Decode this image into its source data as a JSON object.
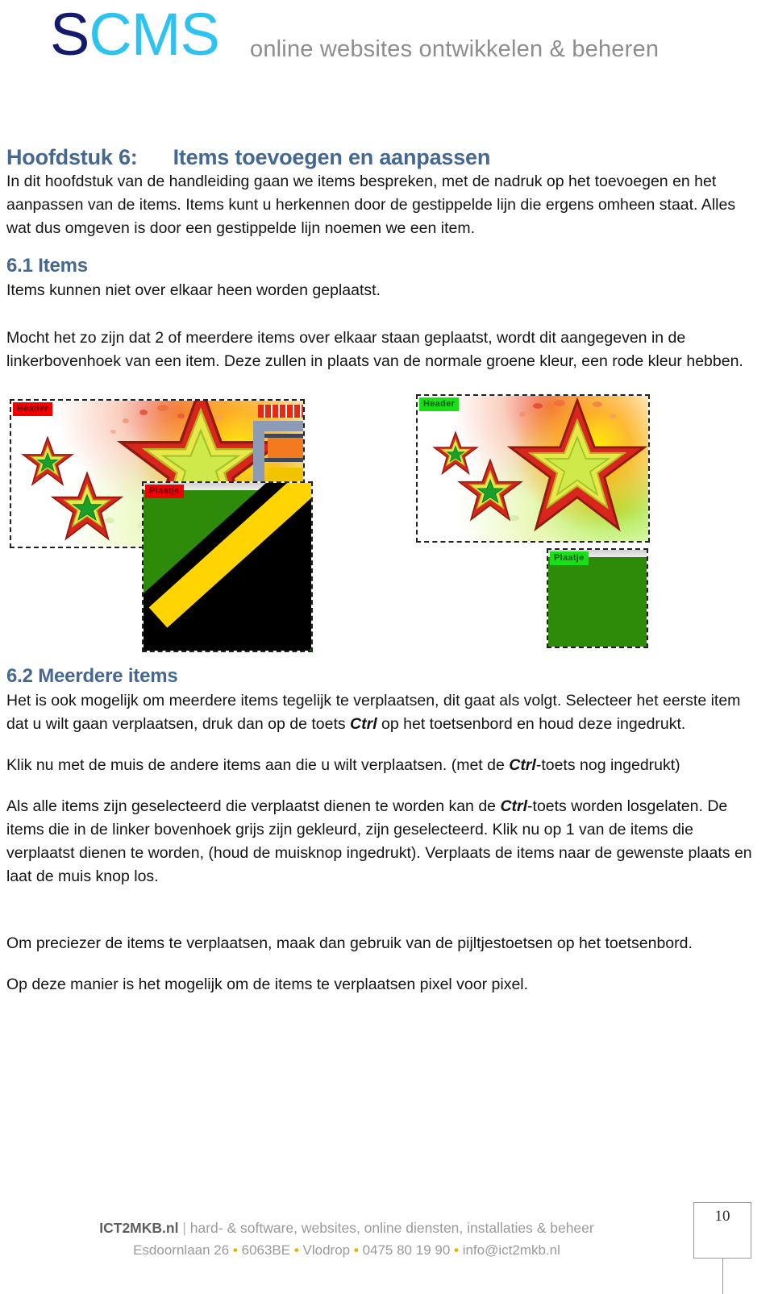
{
  "header": {
    "logo_s": "S",
    "logo_cms": "CMS",
    "tagline": "online websites ontwikkelen & beheren"
  },
  "chapter": {
    "label": "Hoofdstuk 6:",
    "title": "Items toevoegen en aanpassen"
  },
  "intro": "In dit hoofdstuk van de handleiding gaan we items bespreken, met de nadruk op het toevoegen en het aanpassen van de items. Items kunt u herkennen door de gestippelde lijn die ergens omheen staat. Alles wat dus omgeven is door een gestippelde lijn noemen we een item.",
  "section_61": {
    "heading": "6.1 Items",
    "p1": "Items  kunnen niet over elkaar heen worden geplaatst.",
    "p2": "Mocht het zo zijn dat 2 of meerdere items over elkaar staan geplaatst, wordt dit aangegeven in de linkerbovenhoek van een item. Deze zullen in plaats van de normale groene kleur, een rode kleur hebben."
  },
  "figures": {
    "overlapping_example": {
      "header_tag": "Header",
      "plaatje_tag": "Plaatje",
      "tag_state": "overlap",
      "tag_color": "#f20000"
    },
    "normal_example": {
      "header_tag": "Header",
      "plaatje_tag": "Plaatje",
      "tag_state": "normal",
      "tag_color": "#19e016"
    }
  },
  "section_62": {
    "heading": "6.2 Meerdere items",
    "p1_a": "Het is ook mogelijk om meerdere items tegelijk te verplaatsen, dit gaat als volgt. Selecteer het eerste item dat u wilt gaan verplaatsen, druk dan op de toets ",
    "p1_kbd": "Ctrl",
    "p1_b": " op het toetsenbord en houd deze ingedrukt.",
    "p2_a": "Klik nu met de muis de andere items aan die u wilt verplaatsen. (met de ",
    "p2_kbd": "Ctrl",
    "p2_b": "-toets nog ingedrukt)",
    "p3_a": "Als alle items zijn geselecteerd die verplaatst dienen te worden kan de ",
    "p3_kbd": "Ctrl",
    "p3_b": "-toets worden losgelaten. De items die in de linker bovenhoek grijs zijn gekleurd, zijn geselecteerd. Klik nu op 1 van de items die verplaatst dienen te worden, (houd de muisknop ingedrukt). Verplaats de items naar de gewenste plaats en laat de muis knop los.",
    "p4": "Om preciezer de items te verplaatsen, maak dan gebruik van de pijltjestoetsen op het toetsenbord.",
    "p5": "Op deze manier is het mogelijk om de items te verplaatsen pixel voor pixel."
  },
  "footer": {
    "brand": "ICT2MKB.nl",
    "pipe": "|",
    "services": "hard- &  software, websites, online diensten, installaties & beheer",
    "address": "Esdoornlaan 26",
    "postcode": "6063BE",
    "city": "Vlodrop",
    "phone": "0475 80 19 90",
    "email": "info@ict2mkb.nl",
    "bullet": "•",
    "page_number": "10"
  }
}
